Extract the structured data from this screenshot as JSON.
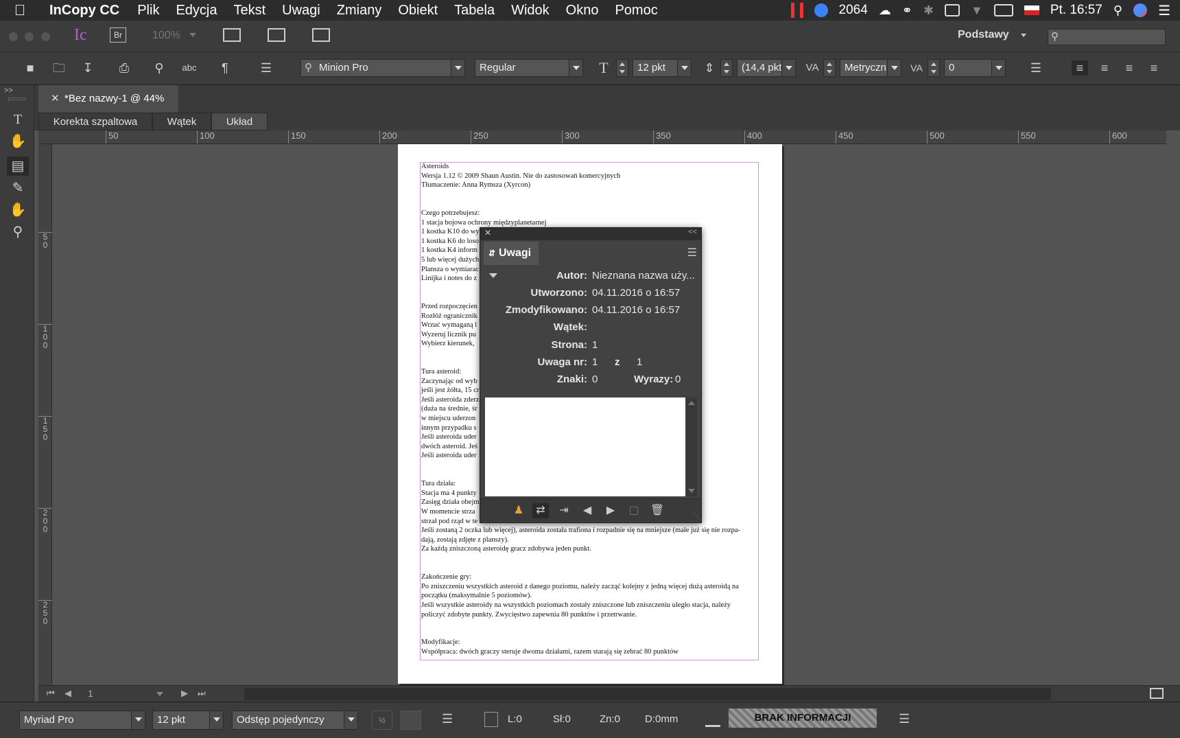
{
  "menubar": {
    "app_name": "InCopy CC",
    "items": [
      "Plik",
      "Edycja",
      "Tekst",
      "Uwagi",
      "Zmiany",
      "Obiekt",
      "Tabela",
      "Widok",
      "Okno",
      "Pomoc"
    ],
    "status_count": "2064",
    "clock": "Pt. 16:57"
  },
  "control": {
    "zoom": "100%",
    "workspace": "Podstawy",
    "font_family": "Minion Pro",
    "font_style": "Regular",
    "font_size": "12 pkt",
    "leading": "(14,4 pkt",
    "kerning": "Metryczn",
    "tracking": "0"
  },
  "document": {
    "tab_title": "*Bez nazwy-1 @ 44%",
    "view_tabs": [
      "Korekta szpaltowa",
      "Wątek",
      "Układ"
    ],
    "ruler_h": [
      "50",
      "100",
      "150",
      "200",
      "250",
      "300",
      "350",
      "400",
      "450",
      "500",
      "550",
      "600"
    ],
    "ruler_v": [
      "5\n0",
      "1\n0\n0",
      "1\n5\n0",
      "2\n0\n0",
      "2\n5\n0"
    ],
    "lines": [
      "Asteroids",
      "Wersja 1.12 © 2009 Shaun Austin. Nie do zastosowań komercyjnych",
      "Tłumaczenie: Anna Rymsza (Xyrcon)",
      "",
      "",
      "Czego potrzebujesz:",
      "1 stacja bojowa ochrony międzyplanetarnej",
      "1 kostka K10 do wy",
      "1 kostka K6 do loso",
      "1 kostka K4 inform",
      "5 lub więcej dużych",
      "Plansza o wymiarac",
      "Linijka i notes do z",
      "",
      "",
      "Przed rozpoczęcien",
      "Rozłóż ogranicznik",
      "Wrzuć wymaganą l                                                                                                    gim i tak dalej)",
      "Wyzeruj licznik pu",
      "Wybierz kierunek,",
      "",
      "",
      "Tura asteroid:",
      "Zaczynając od wyb                                                                                             rzałkę o 10 cm,",
      "jeśli jest żółta, 15 cr",
      "Jeśli asteroida zderz                                                                                           a dwie mniejsze",
      "(duża na średnie, śr                                                                                            dy należy położyć",
      "w miejscu uderzon                                                                                              e) prędkością. W",
      "innym przypadku s",
      "Jeśli asteroida uder                                                                                          ypadku zderzenia",
      "dwóch asteroid. Jeś",
      "Jeśli asteroida uder                                                                                          i prędkość.",
      "",
      "",
      "Tura działa:",
      "Stacja ma 4 punkty                                                                                            b jeden strzał.",
      "Zasięg działa obejm                                                                                           eroida.",
      "W momencie strza                                                                                              o oczko. Za każdy",
      "strzał pod rząd w te",
      "Jeśli zostaną 2 oczka lub więcej), asteroida została trafiona i rozpadnie się na mniejsze (małe już się nie rozpa-",
      "dają, zostają zdjęte z planszy).",
      "Za każdą zniszczoną asteroidę gracz zdobywa jeden punkt.",
      "",
      "",
      "Zakończenie gry:",
      "Po zniszczeniu wszystkich asteroid z danego poziomu, należy zacząć kolejny z jedną więcej dużą asteroidą na",
      "początku (maksymalnie 5 poziomów).",
      "Jeśli wszystkie asteroidy na wszystkich poziomach zostały zniszczone lub zniszczeniu uległo stacja, należy",
      "policzyć zdobyte punkty. Zwycięstwo zapewnia 80 punktów i przetrwanie.",
      "",
      "",
      "Modyfikacje:",
      "Współpraca: dwóch graczy steruje dwoma działami, razem starają się zebrać 80 punktów"
    ]
  },
  "notes_panel": {
    "title": "Uwagi",
    "author_label": "Autor:",
    "author_value": "Nieznana nazwa uży...",
    "created_label": "Utworzono:",
    "created_value": "04.11.2016 o 16:57",
    "modified_label": "Zmodyfikowano:",
    "modified_value": "04.11.2016 o 16:57",
    "thread_label": "Wątek:",
    "thread_value": "",
    "page_label": "Strona:",
    "page_value": "1",
    "note_label": "Uwaga nr:",
    "note_value": "1",
    "note_of": "z",
    "note_total": "1",
    "chars_label": "Znaki:",
    "chars_value": "0",
    "words_label": "Wyrazy:",
    "words_value": "0"
  },
  "nav": {
    "page_number": "1"
  },
  "statusbar": {
    "font": "Myriad Pro",
    "size": "12 pkt",
    "spacing": "Odstęp pojedynczy",
    "line": "L:0",
    "words": "Sł:0",
    "chars": "Zn:0",
    "depth": "D:0mm",
    "info": "BRAK INFORMACJI"
  }
}
